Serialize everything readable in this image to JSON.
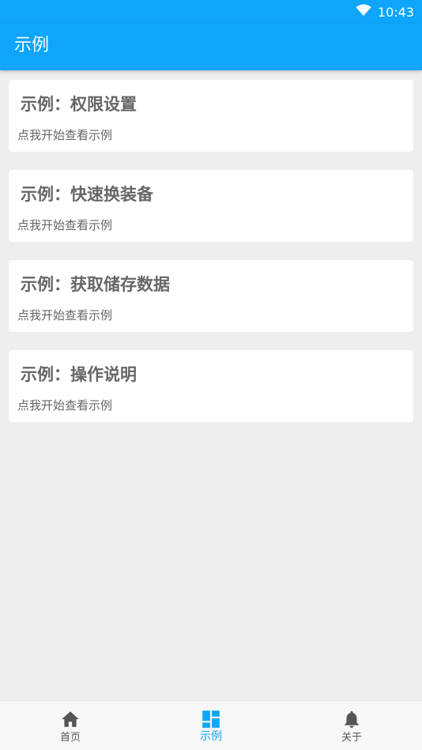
{
  "status_bar": {
    "time": "10:43",
    "icons": [
      "wifi-icon"
    ]
  },
  "app_bar": {
    "title": "示例"
  },
  "cards": [
    {
      "title": "示例：权限设置",
      "subtitle": "点我开始查看示例"
    },
    {
      "title": "示例：快速换装备",
      "subtitle": "点我开始查看示例"
    },
    {
      "title": "示例：获取储存数据",
      "subtitle": "点我开始查看示例"
    },
    {
      "title": "示例：操作说明",
      "subtitle": "点我开始查看示例"
    }
  ],
  "bottom_nav": {
    "items": [
      {
        "label": "首页",
        "icon": "home-icon",
        "active": false
      },
      {
        "label": "示例",
        "icon": "dashboard-icon",
        "active": true
      },
      {
        "label": "关于",
        "icon": "bell-icon",
        "active": false
      }
    ]
  },
  "colors": {
    "primary": "#0ea5fb",
    "background": "#eeeeee",
    "card": "#ffffff",
    "text": "#666666",
    "nav_inactive": "#555555"
  }
}
